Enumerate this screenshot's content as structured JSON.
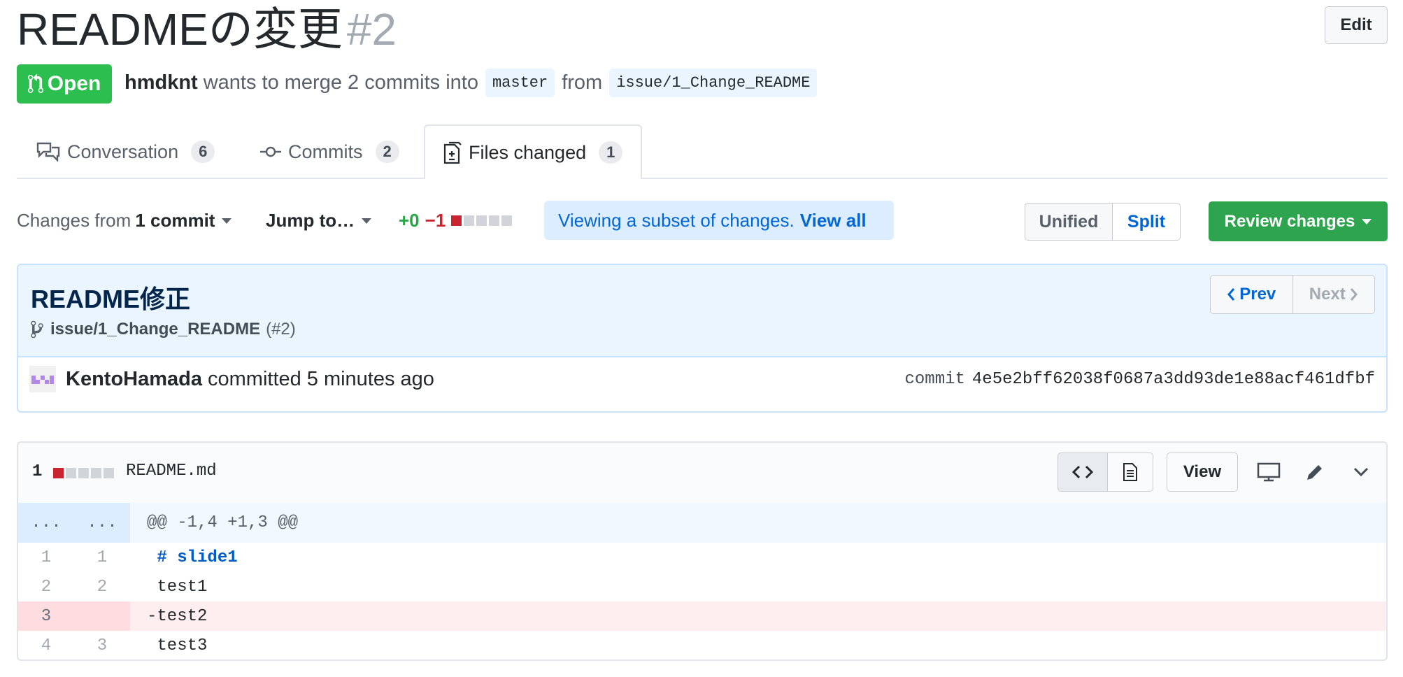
{
  "pr": {
    "title": "READMEの変更",
    "number": "#2",
    "edit_label": "Edit",
    "state": "Open",
    "author": "hmdknt",
    "merge_text": "wants to merge 2 commits into",
    "base_branch": "master",
    "from_text": "from",
    "head_branch": "issue/1_Change_README"
  },
  "tabs": [
    {
      "label": "Conversation",
      "count": "6",
      "icon": "comment-discussion-icon"
    },
    {
      "label": "Commits",
      "count": "2",
      "icon": "git-commit-icon"
    },
    {
      "label": "Files changed",
      "count": "1",
      "icon": "file-diff-icon",
      "selected": true
    }
  ],
  "toolbar": {
    "changes_prefix": "Changes from",
    "changes_value": "1 commit",
    "jump_label": "Jump to…",
    "additions": "+0",
    "deletions": "−1",
    "notice_text": "Viewing a subset of changes.",
    "notice_link": "View all",
    "unified_label": "Unified",
    "split_label": "Split",
    "review_label": "Review changes"
  },
  "commit": {
    "title": "README修正",
    "branch": "issue/1_Change_README",
    "pr_ref": "(#2)",
    "prev_label": "Prev",
    "next_label": "Next",
    "author": "KentoHamada",
    "action": "committed",
    "time": "5 minutes ago",
    "sha_label": "commit",
    "sha": "4e5e2bff62038f0687a3dd93de1e88acf461dfbf"
  },
  "file": {
    "changes": "1",
    "name": "README.md",
    "view_label": "View",
    "hunk_old": "...",
    "hunk_new": "...",
    "hunk_header": "@@ -1,4 +1,3 @@",
    "lines": [
      {
        "old": "1",
        "new": "1",
        "sign": " ",
        "text": "# slide1",
        "type": "context",
        "heading": true
      },
      {
        "old": "2",
        "new": "2",
        "sign": " ",
        "text": "test1",
        "type": "context"
      },
      {
        "old": "3",
        "new": "",
        "sign": "-",
        "text": "test2",
        "type": "deletion"
      },
      {
        "old": "4",
        "new": "3",
        "sign": " ",
        "text": "test3",
        "type": "context"
      }
    ]
  },
  "colors": {
    "open_green": "#2cbe4e",
    "review_green": "#2ea44f",
    "link_blue": "#0366d6",
    "addition_green": "#28a745",
    "deletion_red": "#cb2431",
    "deletion_bg": "#ffeef0"
  }
}
